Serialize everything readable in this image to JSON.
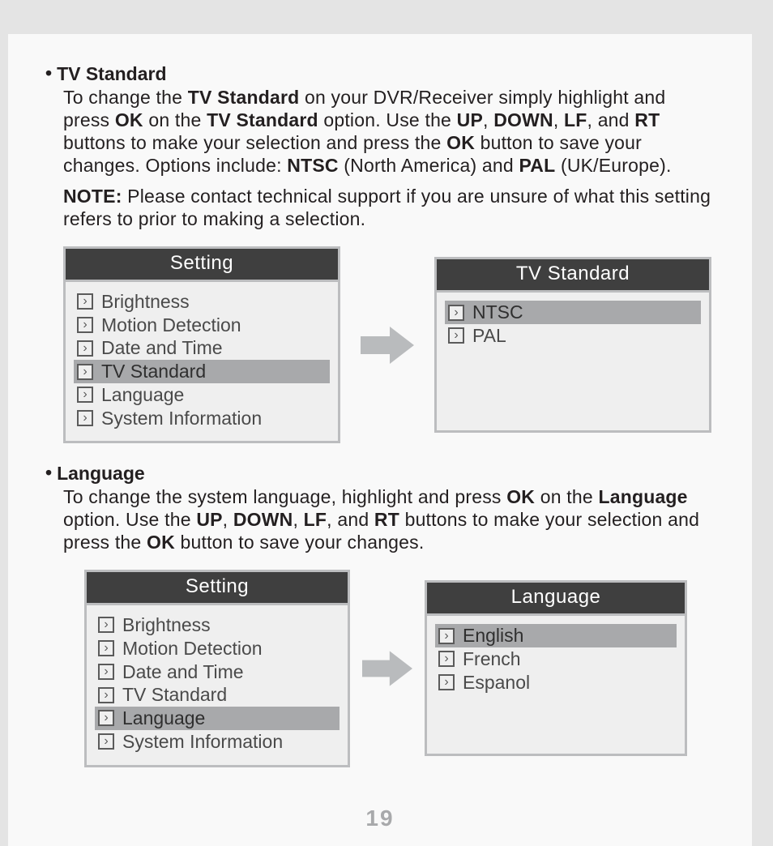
{
  "pageNumber": "19",
  "section1": {
    "title": "TV Standard",
    "para": "To change the <b>TV Standard</b> on your DVR/Receiver simply highlight and press <b>OK</b> on the <b>TV Standard</b> option. Use the <b>UP</b>, <b>DOWN</b>, <b>LF</b>, and <b>RT</b> buttons to make your selection and press the <b>OK</b> button to save your changes. Options include: <b>NTSC</b> (North America) and <b>PAL</b> (UK/Europe).",
    "noteLabel": "NOTE:",
    "noteText": "Please contact technical support if you are unsure of what this setting refers to prior to making a selection.",
    "leftMenu": {
      "title": "Setting",
      "items": [
        "Brightness",
        "Motion Detection",
        "Date and Time",
        "TV Standard",
        "Language",
        "System Information"
      ],
      "selectedIndex": 3
    },
    "rightMenu": {
      "title": "TV Standard",
      "items": [
        "NTSC",
        "PAL"
      ],
      "selectedIndex": 0
    }
  },
  "section2": {
    "title": "Language",
    "para": "To change the system language, highlight and press <b>OK</b> on the <b>Language</b> option. Use the <b>UP</b>, <b>DOWN</b>, <b>LF</b>, and <b>RT</b> buttons to make your selection and press the <b>OK</b> button to save your changes.",
    "leftMenu": {
      "title": "Setting",
      "items": [
        "Brightness",
        "Motion Detection",
        "Date and Time",
        "TV Standard",
        "Language",
        "System Information"
      ],
      "selectedIndex": 4
    },
    "rightMenu": {
      "title": "Language",
      "items": [
        "English",
        "French",
        "Espanol"
      ],
      "selectedIndex": 0
    }
  }
}
